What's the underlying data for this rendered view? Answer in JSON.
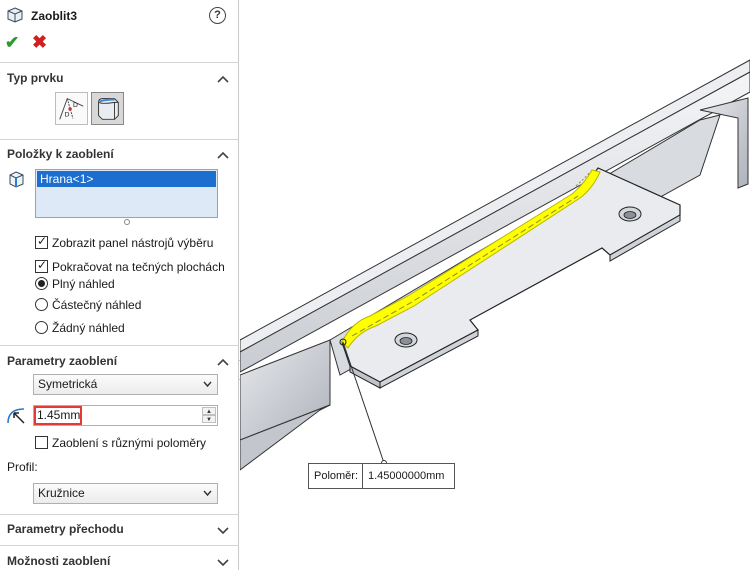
{
  "feature": {
    "title": "Zaoblit3",
    "help_symbol": "?",
    "ok_symbol": "✔",
    "cancel_symbol": "✖"
  },
  "sections": {
    "typ_prvku": "Typ prvku",
    "polozky": "Položky k zaoblení",
    "parametry": "Parametry zaoblení",
    "prechod": "Parametry přechodu",
    "moznosti": "Možnosti zaoblení"
  },
  "items_list": [
    "Hrana<1>"
  ],
  "options": {
    "show_toolbar": "Zobrazit panel nástrojů výběru",
    "tangent": "Pokračovat na tečných plochách",
    "full_preview": "Plný náhled",
    "partial_preview": "Částečný náhled",
    "no_preview": "Žádný náhled"
  },
  "params": {
    "type_value": "Symetrická",
    "radius_value": "1.45mm",
    "multi_radius": "Zaoblení s různými poloměry",
    "profile_label": "Profil:",
    "profile_value": "Kružnice"
  },
  "callout": {
    "key": "Poloměr:",
    "value": "1.45000000mm"
  },
  "state": {
    "show_toolbar_checked": true,
    "tangent_checked": true,
    "preview_mode": "full_preview",
    "multi_radius_checked": false,
    "active_feature_type": "constant_size"
  },
  "colors": {
    "selection_highlight": "#ffff00",
    "list_selected": "#1c6ecf",
    "radius_box_border": "#e53935",
    "accept": "#2e9a2e",
    "reject": "#d02020"
  },
  "icons": [
    "part-icon",
    "help-icon",
    "ok-icon",
    "cancel-icon",
    "variable-size-fillet-icon",
    "constant-size-fillet-icon",
    "edge-selection-icon",
    "radius-icon",
    "chevron-up-icon",
    "chevron-down-icon"
  ]
}
